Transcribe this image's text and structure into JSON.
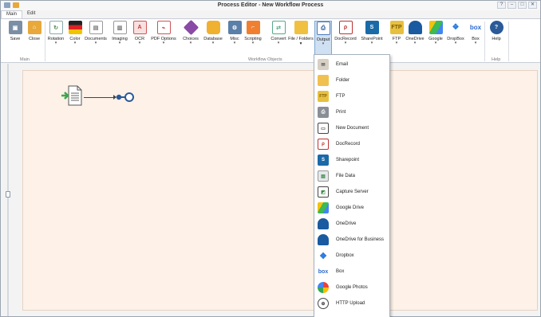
{
  "window": {
    "title": "Process Editor - New Workflow Process",
    "controls": {
      "help": "?",
      "minimize": "–",
      "maximize": "□",
      "close": "✕"
    }
  },
  "tabs": [
    "Main",
    "Edit"
  ],
  "ribbon": {
    "buttons": {
      "save": "Save",
      "close": "Close",
      "rotation": "Rotation",
      "color": "Color",
      "documents": "Documents",
      "imaging": "Imaging",
      "ocr": "OCR",
      "pdf": "PDF Options",
      "choices": "Choices",
      "database": "Database",
      "misc": "Misc",
      "scripting": "Scripting",
      "convert": "Convert",
      "file_folder": "File / Folders ▾",
      "output": "Output",
      "docrecord": "DocRecord",
      "sharepoint": "SharePoint",
      "ftp": "FTP",
      "onedrive": "OneDrive",
      "google": "Google",
      "dropbox": "DropBox",
      "box": "Box",
      "help": "Help"
    },
    "groups": {
      "main": "Main",
      "workflow": "Workflow Objects",
      "help": "Help"
    }
  },
  "output_menu": {
    "items": [
      "Email",
      "Folder",
      "FTP",
      "Print",
      "New Document",
      "DocRecord",
      "Sharepoint",
      "File Data",
      "Capture Server",
      "Google Drive",
      "OneDrive",
      "OneDrive for Business",
      "Dropbox",
      "Box",
      "Google Photos",
      "HTTP Upload"
    ]
  }
}
